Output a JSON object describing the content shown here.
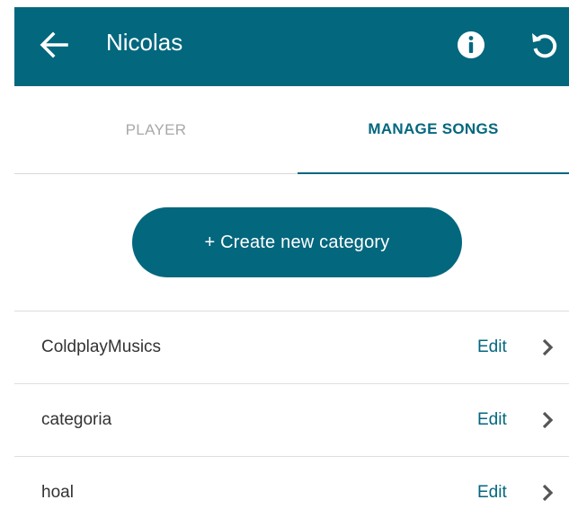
{
  "colors": {
    "primary": "#03677e",
    "inactive_tab": "#a9a9a9",
    "text": "#333333"
  },
  "header": {
    "title": "Nicolas",
    "icons": [
      "arrow-left-icon",
      "info-icon",
      "refresh-icon"
    ]
  },
  "tabs": [
    {
      "label": "PLAYER",
      "active": false
    },
    {
      "label": "MANAGE SONGS",
      "active": true
    }
  ],
  "create_button": {
    "label": "+ Create new category"
  },
  "categories": [
    {
      "name": "ColdplayMusics",
      "action": "Edit"
    },
    {
      "name": "categoria",
      "action": "Edit"
    },
    {
      "name": "hoal",
      "action": "Edit"
    }
  ]
}
